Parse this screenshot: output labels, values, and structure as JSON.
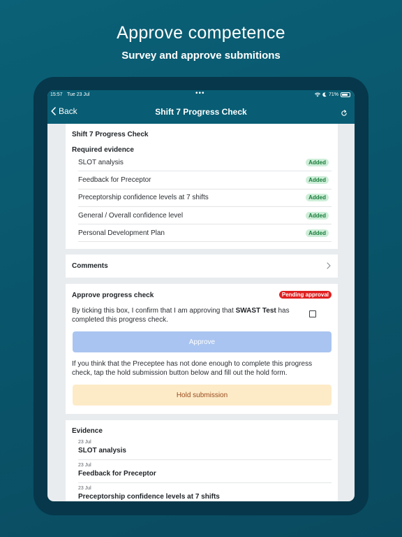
{
  "promo": {
    "title": "Approve competence",
    "subtitle": "Survey and approve submitions"
  },
  "statusbar": {
    "time": "15:57",
    "date": "Tue 23 Jul",
    "dots": "•••",
    "battery": "71%"
  },
  "navbar": {
    "back_label": "Back",
    "title": "Shift 7 Progress Check"
  },
  "evidence_card": {
    "title": "Shift 7 Progress Check",
    "required_label": "Required evidence",
    "items": [
      {
        "label": "SLOT analysis",
        "status": "Added"
      },
      {
        "label": "Feedback for Preceptor",
        "status": "Added"
      },
      {
        "label": "Preceptorship confidence levels at 7 shifts",
        "status": "Added"
      },
      {
        "label": "General / Overall confidence level",
        "status": "Added"
      },
      {
        "label": "Personal Development Plan",
        "status": "Added"
      }
    ]
  },
  "comments": {
    "label": "Comments"
  },
  "approve": {
    "title": "Approve progress check",
    "status_badge": "Pending approval",
    "confirm_prefix": "By ticking this box, I confirm that I am approving that ",
    "confirm_name": "SWAST Test",
    "confirm_suffix": " has completed this progress check.",
    "approve_button": "Approve",
    "hold_text": "If you think that the Preceptee has not done enough to complete this progress check, tap the hold submission button below and fill out the hold form.",
    "hold_button": "Hold submission"
  },
  "evidence_list": {
    "title": "Evidence",
    "items": [
      {
        "date": "23 Jul",
        "name": "SLOT analysis"
      },
      {
        "date": "23 Jul",
        "name": "Feedback for Preceptor"
      },
      {
        "date": "23 Jul",
        "name": "Preceptorship confidence levels at 7 shifts"
      }
    ]
  },
  "colors": {
    "background": "#0a5a70",
    "navbar": "#085d74",
    "added_badge": "#cdeed8",
    "pending_badge": "#e02020",
    "approve_button": "#a9c4f0",
    "hold_button": "#fdebc8"
  }
}
